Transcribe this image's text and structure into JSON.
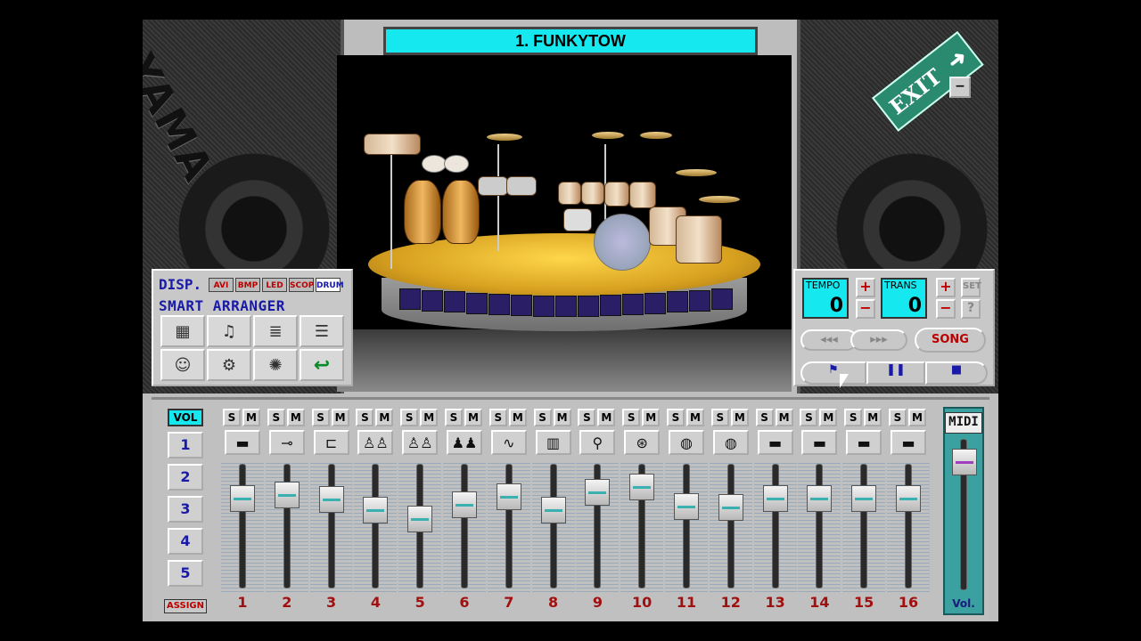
{
  "window": {
    "title": "1. FUNKYTOW"
  },
  "exit": {
    "label": "EXIT",
    "arrow_icon": "arrow-up-right-icon",
    "minimize_label": "−"
  },
  "speaker": {
    "logo_text": "YAMAHA"
  },
  "arranger": {
    "disp_label": "DISP.",
    "disp_buttons": [
      {
        "label": "AVI",
        "active": false
      },
      {
        "label": "BMP",
        "active": false
      },
      {
        "label": "LED",
        "active": false
      },
      {
        "label": "SCOP",
        "active": false
      },
      {
        "label": "DRUM",
        "active": true
      }
    ],
    "title": "SMART ARRANGER",
    "tiles": [
      {
        "icon": "drum-machine-icon",
        "glyph": "▦"
      },
      {
        "icon": "music-stand-icon",
        "glyph": "♫"
      },
      {
        "icon": "xylophone-icon",
        "glyph": "≣"
      },
      {
        "icon": "mixer-icon",
        "glyph": "☰"
      },
      {
        "icon": "band-members-icon",
        "glyph": "☺"
      },
      {
        "icon": "robot-icon",
        "glyph": "⚙"
      },
      {
        "icon": "color-burst-icon",
        "glyph": "✺"
      },
      {
        "icon": "return-arrow-icon",
        "glyph": "↩"
      }
    ]
  },
  "controls": {
    "tempo": {
      "label": "TEMPO",
      "value": "0"
    },
    "trans": {
      "label": "TRANS",
      "value": "0"
    },
    "plus": "+",
    "minus": "−",
    "set_label": "SET",
    "help_label": "?",
    "rewind": "◂◂◂",
    "forward": "▸▸▸",
    "song_label": "SONG",
    "play_icon": "⚑",
    "pause_icon": "❚❚",
    "stop_icon": "■"
  },
  "mixer": {
    "vol_label": "VOL",
    "banks": [
      "1",
      "2",
      "3",
      "4",
      "5"
    ],
    "assign_label": "ASSIGN",
    "solo_label": "S",
    "mute_label": "M",
    "master_logo": "MIDI",
    "master_label": "Vol.",
    "master_level": 0.92,
    "channels": [
      {
        "number": "1",
        "icon": "lead-instrument-icon",
        "glyph": "▬",
        "level": 0.78
      },
      {
        "number": "2",
        "icon": "guitar-icon",
        "glyph": "⊸",
        "level": 0.82
      },
      {
        "number": "3",
        "icon": "trumpet-icon",
        "glyph": "⊏",
        "level": 0.77
      },
      {
        "number": "4",
        "icon": "choir-icon",
        "glyph": "♙♙",
        "level": 0.66
      },
      {
        "number": "5",
        "icon": "choir-icon",
        "glyph": "♙♙",
        "level": 0.57
      },
      {
        "number": "6",
        "icon": "people-icon",
        "glyph": "♟♟",
        "level": 0.72
      },
      {
        "number": "7",
        "icon": "saxophone-icon",
        "glyph": "∿",
        "level": 0.8
      },
      {
        "number": "8",
        "icon": "keyboard-icon",
        "glyph": "▥",
        "level": 0.66
      },
      {
        "number": "9",
        "icon": "electric-guitar-icon",
        "glyph": "⚲",
        "level": 0.85
      },
      {
        "number": "10",
        "icon": "drum-kit-icon",
        "glyph": "⊛",
        "level": 0.9
      },
      {
        "number": "11",
        "icon": "percussion-icon",
        "glyph": "◍",
        "level": 0.7
      },
      {
        "number": "12",
        "icon": "percussion-icon",
        "glyph": "◍",
        "level": 0.69
      },
      {
        "number": "13",
        "icon": "lead-instrument-icon",
        "glyph": "▬",
        "level": 0.78
      },
      {
        "number": "14",
        "icon": "lead-instrument-icon",
        "glyph": "▬",
        "level": 0.78
      },
      {
        "number": "15",
        "icon": "lead-instrument-icon",
        "glyph": "▬",
        "level": 0.78
      },
      {
        "number": "16",
        "icon": "lead-instrument-icon",
        "glyph": "▬",
        "level": 0.78
      }
    ]
  }
}
